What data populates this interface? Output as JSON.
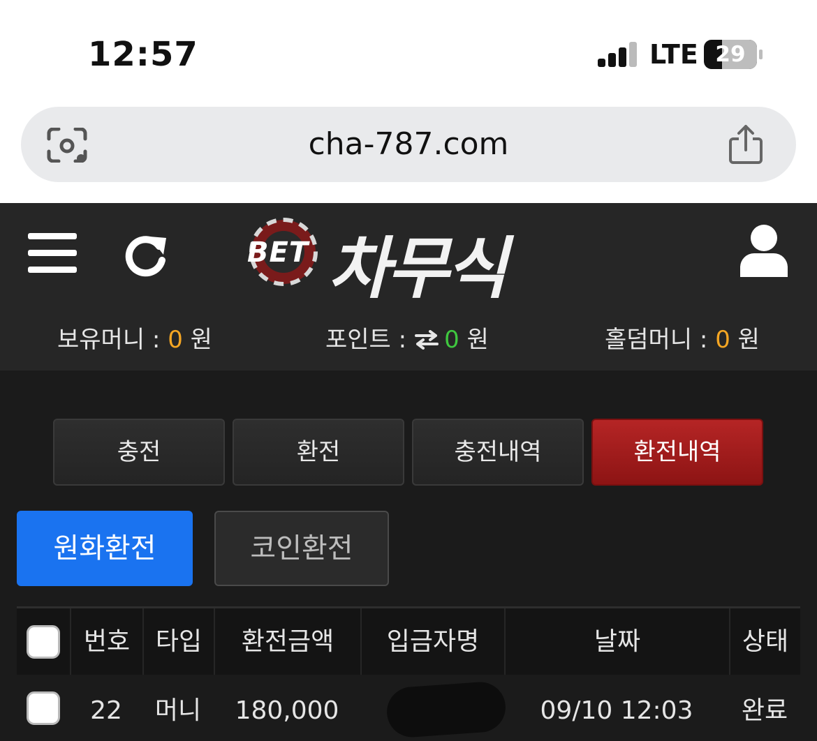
{
  "status_bar": {
    "time": "12:57",
    "network": "LTE",
    "battery": "29"
  },
  "browser": {
    "url": "cha-787.com"
  },
  "site": {
    "logo_small": "BET",
    "logo_name": "차무식",
    "balances": [
      {
        "label": "보유머니 :",
        "value": "0",
        "unit": "원"
      },
      {
        "label": "포인트 :",
        "value": "0",
        "unit": "원"
      },
      {
        "label": "홀덤머니 :",
        "value": "0",
        "unit": "원"
      }
    ],
    "tabs": [
      "충전",
      "환전",
      "충전내역",
      "환전내역"
    ],
    "active_tab": "환전내역",
    "subtabs": [
      "원화환전",
      "코인환전"
    ],
    "table": {
      "headers": [
        "번호",
        "타입",
        "환전금액",
        "입금자명",
        "날짜",
        "상태"
      ],
      "rows": [
        {
          "no": "22",
          "type": "머니",
          "amount": "180,000",
          "depositor": "",
          "date": "09/10 12:03",
          "status": "완료"
        }
      ]
    }
  },
  "colors": {
    "accent_red": "#a81d1d",
    "accent_blue": "#1a73f0",
    "value_orange": "#f5a623",
    "value_green": "#3fc73f"
  }
}
